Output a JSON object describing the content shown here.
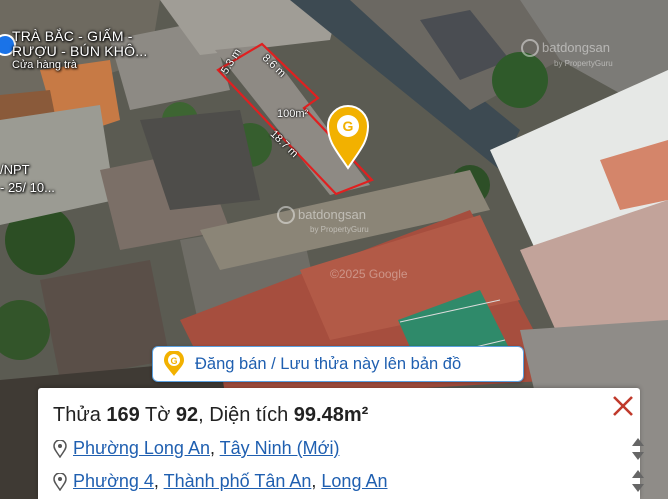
{
  "map": {
    "poi": {
      "title_line1": "TRÀ BẮC - GIẤM -",
      "title_line2": "RƯỢU - BÚN KHÔ...",
      "subtitle": "Cửa hàng trà"
    },
    "edge_labels": [
      "/NPT",
      "- 25/ 10..."
    ],
    "parcel": {
      "area_label": "100m²",
      "dims": [
        "5.3 m",
        "8.6 m",
        "18.7 m"
      ]
    },
    "watermark": "batdongsan",
    "watermark_sub": "by PropertyGuru",
    "copyright": "©2025 Google",
    "marker_letter": "G",
    "colors": {
      "parcel_outline": "#e02020",
      "marker": "#f2b100",
      "link": "#1f5fb0",
      "close": "#c0392b"
    }
  },
  "post_button": {
    "icon": "location-pin-g-icon",
    "label": "Đăng bán / Lưu thửa này lên bản đồ"
  },
  "info_panel": {
    "lot_prefix": "Thửa",
    "lot_number": "169",
    "sheet_prefix": "Tờ",
    "sheet_number": "92",
    "area_prefix": ", Diện tích",
    "area_value": "99.48m²",
    "address_new": {
      "ward": "Phường Long An",
      "sep": ", ",
      "province": "Tây Ninh (Mới)"
    },
    "address_old": {
      "ward": "Phường 4",
      "sep1": ", ",
      "city": "Thành phố Tân An",
      "sep2": ", ",
      "province": "Long An"
    },
    "close_icon": "close-x-icon"
  }
}
